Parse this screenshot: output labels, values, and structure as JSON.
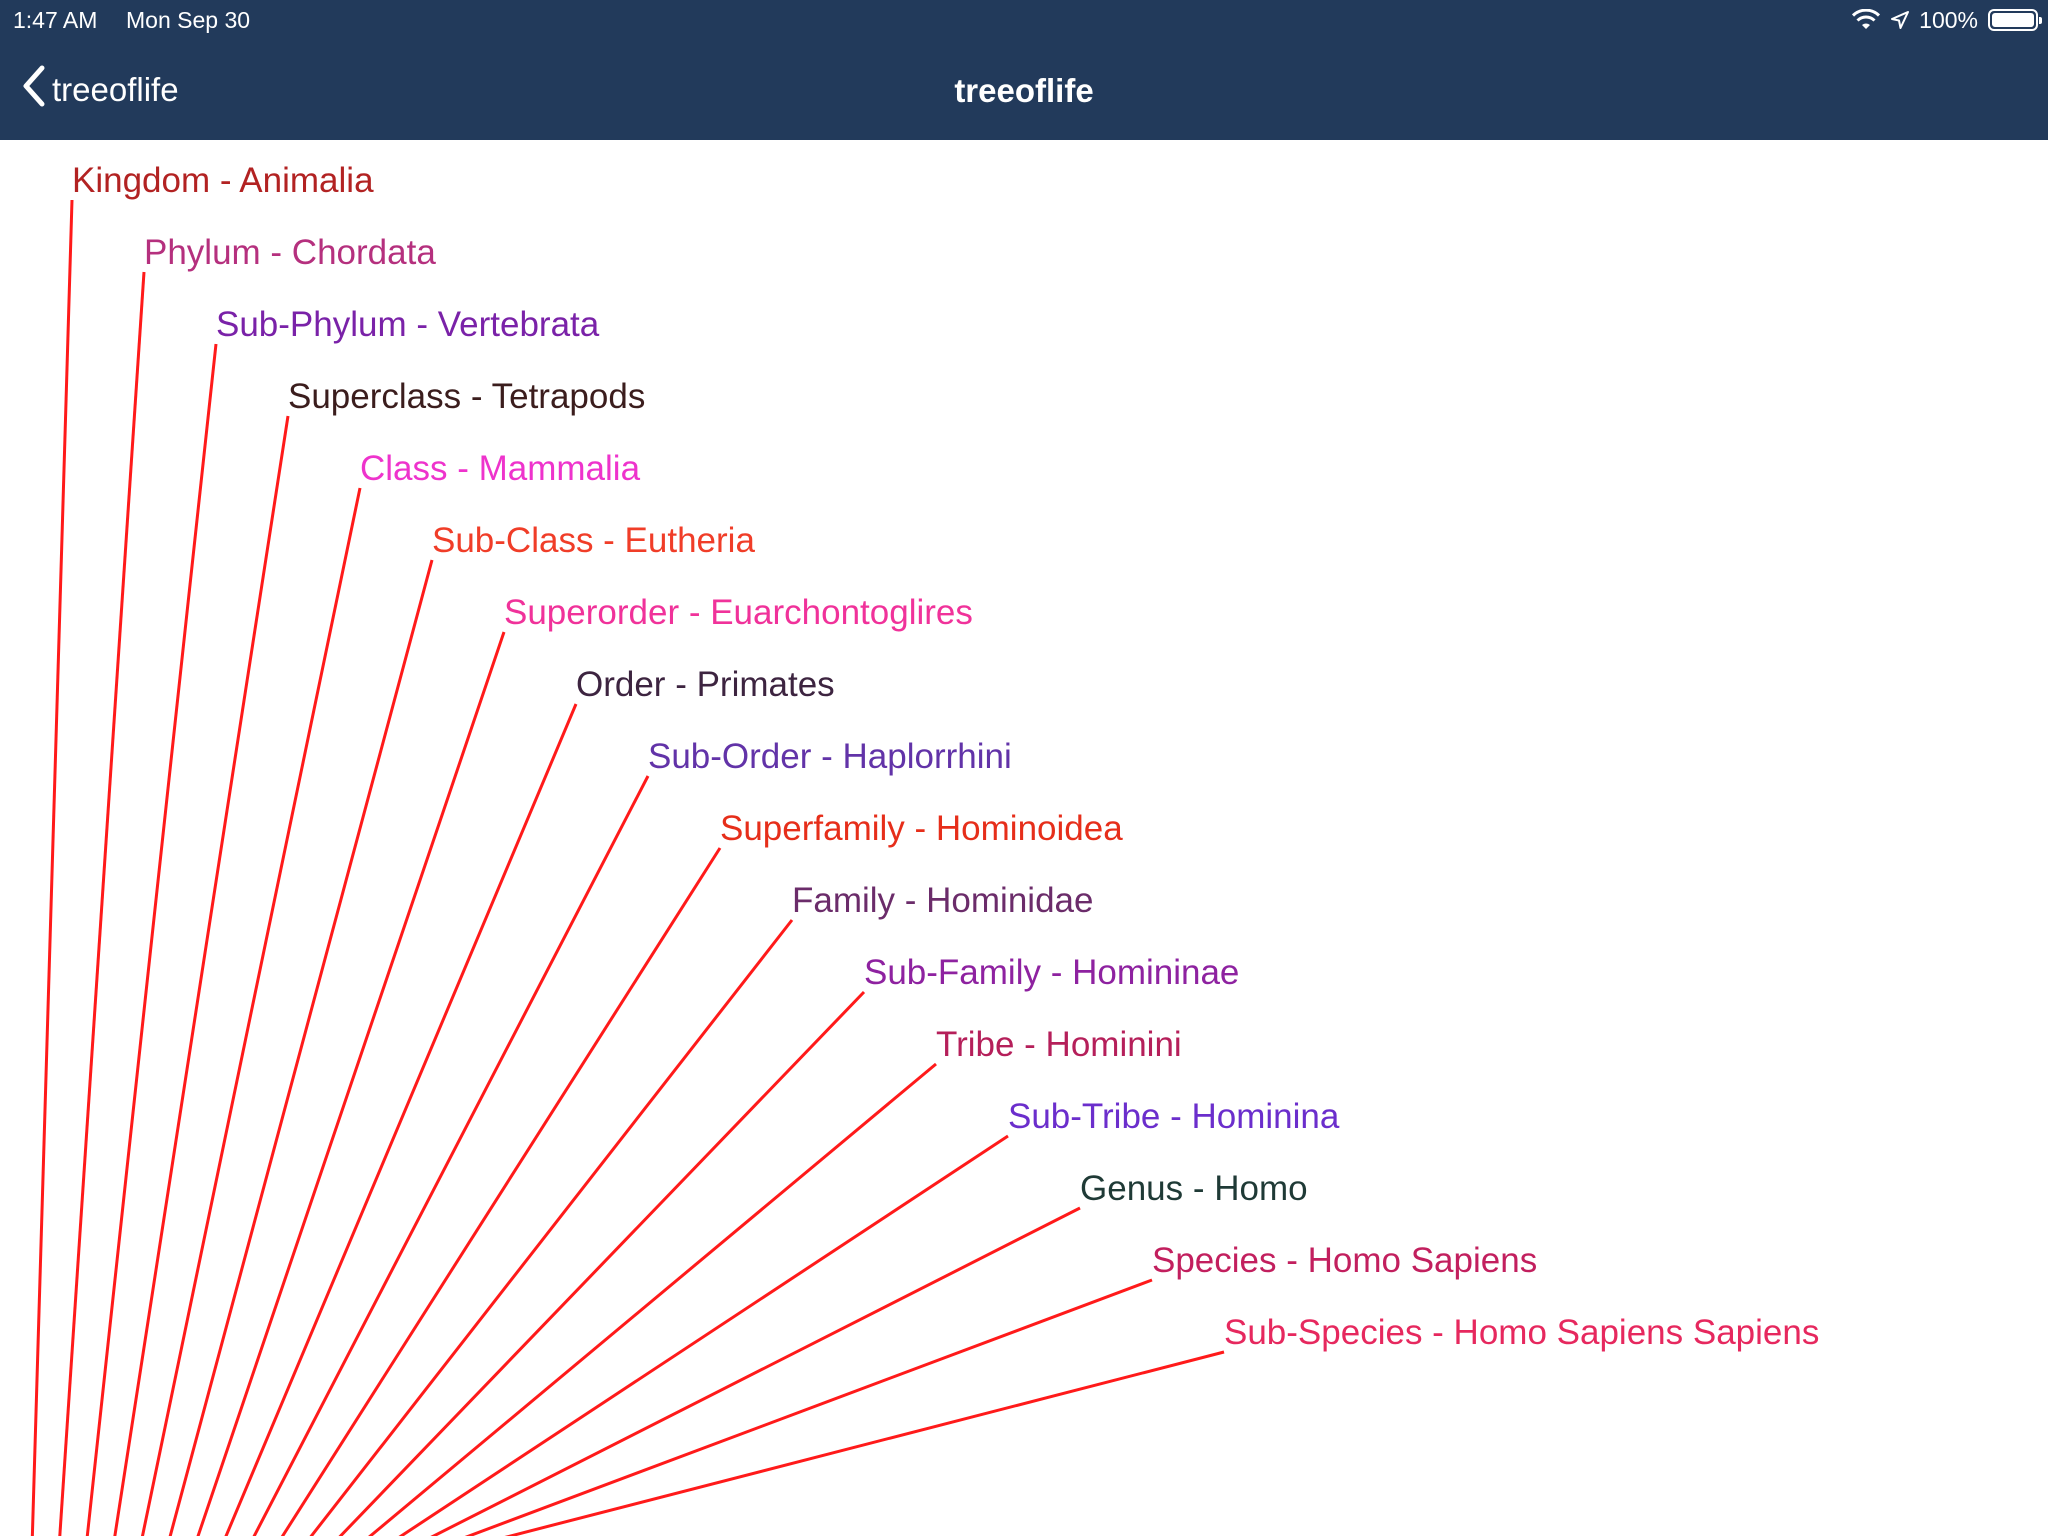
{
  "status_bar": {
    "time": "1:47 AM",
    "date": "Mon Sep 30",
    "battery_text": "100%",
    "battery_level": 1.0,
    "icons": [
      "wifi-icon",
      "location-arrow-icon",
      "battery-icon"
    ]
  },
  "nav": {
    "back_label": "treeoflife",
    "title": "treeoflife",
    "back_icon": "chevron-left-icon"
  },
  "colors": {
    "header_bg": "#223a5b",
    "branch_line": "#ff1a1a"
  },
  "tree": {
    "nodes": [
      {
        "label": "Kingdom - Animalia",
        "color": "#b22222"
      },
      {
        "label": "Phylum - Chordata",
        "color": "#b5307e"
      },
      {
        "label": "Sub-Phylum - Vertebrata",
        "color": "#7a22a8"
      },
      {
        "label": "Superclass - Tetrapods",
        "color": "#3b1d1d"
      },
      {
        "label": "Class - Mammalia",
        "color": "#ee33cc"
      },
      {
        "label": "Sub-Class - Eutheria",
        "color": "#f03d28"
      },
      {
        "label": "Superorder - Euarchontoglires",
        "color": "#f0329a"
      },
      {
        "label": "Order - Primates",
        "color": "#3d2440"
      },
      {
        "label": "Sub-Order - Haplorrhini",
        "color": "#6233a8"
      },
      {
        "label": "Superfamily - Hominoidea",
        "color": "#e62e1a"
      },
      {
        "label": "Family - Hominidae",
        "color": "#6b2c6a"
      },
      {
        "label": "Sub-Family - Homininae",
        "color": "#8e22a0"
      },
      {
        "label": "Tribe - Hominini",
        "color": "#b51f5a"
      },
      {
        "label": "Sub-Tribe - Hominina",
        "color": "#6b2ecc"
      },
      {
        "label": "Genus - Homo",
        "color": "#1f3a36"
      },
      {
        "label": "Species - Homo Sapiens",
        "color": "#c21f5e"
      },
      {
        "label": "Sub-Species - Homo Sapiens Sapiens",
        "color": "#e6285e"
      }
    ]
  }
}
